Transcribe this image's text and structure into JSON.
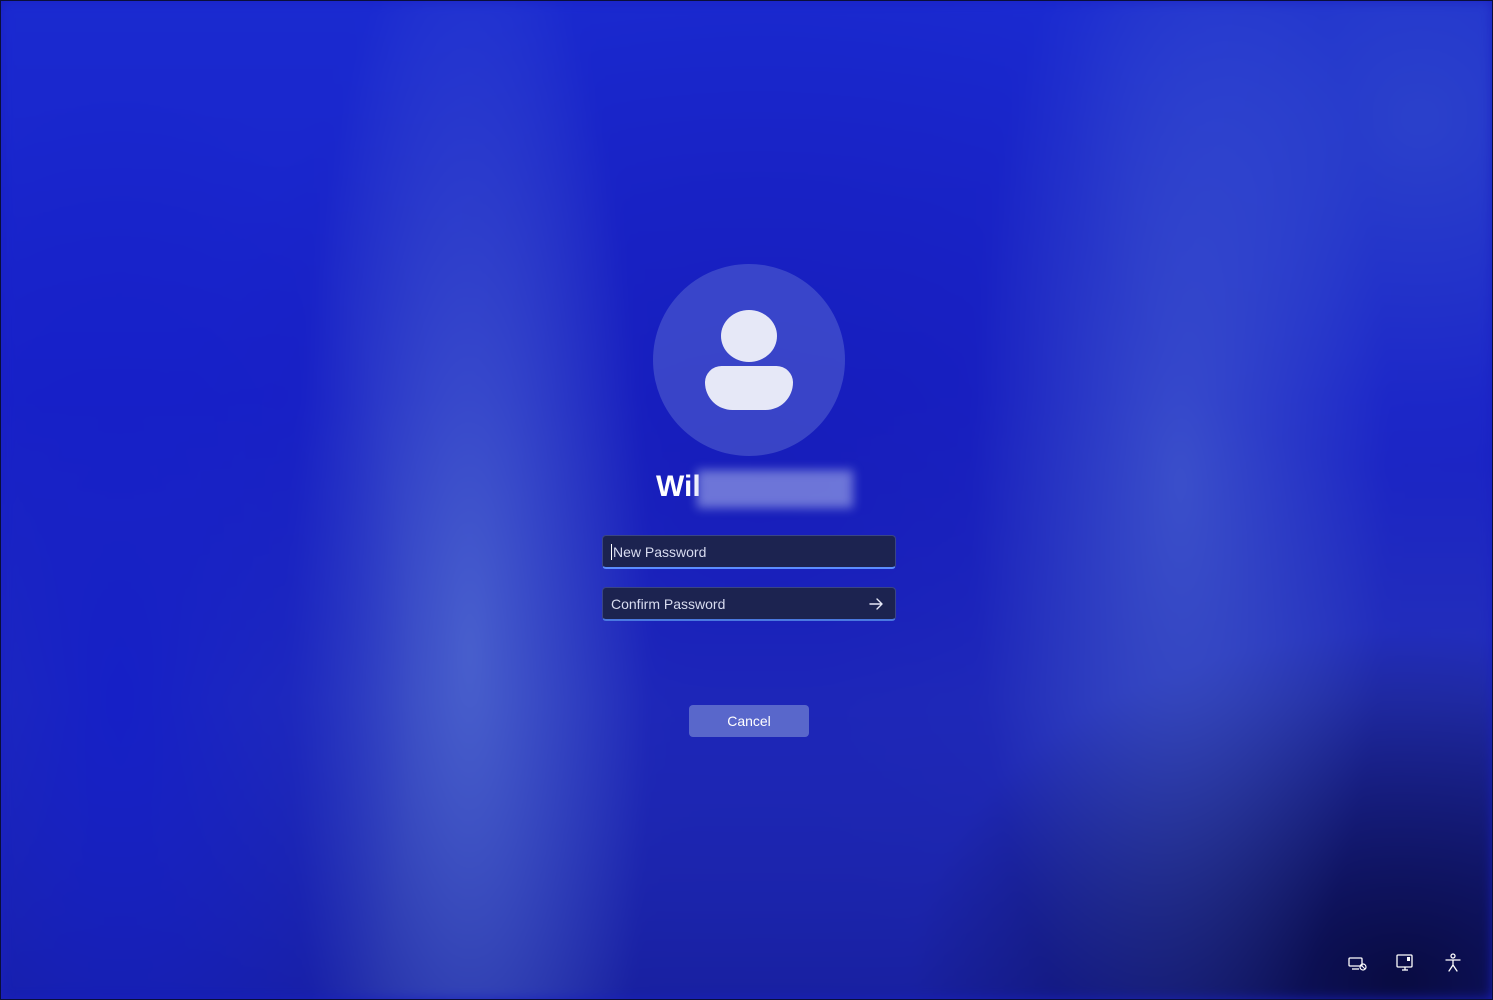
{
  "user": {
    "avatar_icon": "person-icon",
    "name_visible": "Wil"
  },
  "form": {
    "new_password_placeholder": "New Password",
    "confirm_password_placeholder": "Confirm Password",
    "submit_icon": "arrow-right-icon",
    "cancel_label": "Cancel"
  },
  "tray": {
    "icons": [
      "network-icon",
      "display-icon",
      "accessibility-icon"
    ]
  },
  "colors": {
    "background": "#1a1fc0",
    "input_background": "#1c2350",
    "input_accent": "#5b8cff",
    "cancel_button": "#6e7dd2"
  }
}
